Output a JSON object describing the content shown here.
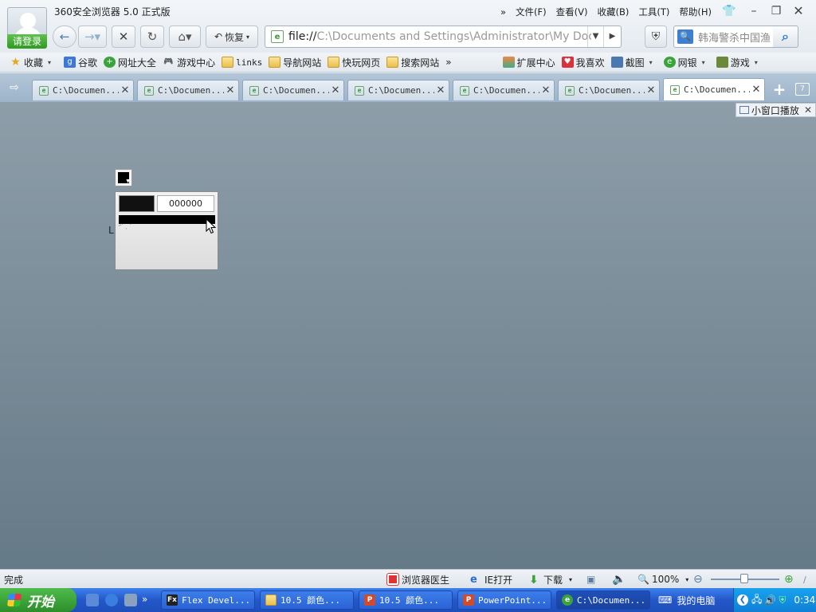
{
  "window": {
    "title": "360安全浏览器 5.0 正式版",
    "login_label": "请登录",
    "menu": [
      "»",
      "文件(F)",
      "查看(V)",
      "收藏(B)",
      "工具(T)",
      "帮助(H)"
    ],
    "restore_label": "恢复"
  },
  "address": {
    "scheme": "file://",
    "path": "C:\\Documents and Settings\\Administrator\\My Documen"
  },
  "search": {
    "placeholder": "韩海警杀中国渔"
  },
  "bookmarks": {
    "left": [
      {
        "label": "收藏",
        "icon": "star-icon"
      },
      {
        "label": "谷歌",
        "icon": "google-icon"
      },
      {
        "label": "网址大全",
        "icon": "url-guide-icon"
      },
      {
        "label": "游戏中心",
        "icon": "gamepad-icon"
      },
      {
        "label": "links",
        "icon": "folder-icon"
      },
      {
        "label": "导航网站",
        "icon": "folder-icon"
      },
      {
        "label": "快玩网页",
        "icon": "folder-icon"
      },
      {
        "label": "搜索网站",
        "icon": "folder-icon"
      }
    ],
    "more": "»",
    "right": [
      {
        "label": "扩展中心",
        "icon": "extension-icon"
      },
      {
        "label": "我喜欢",
        "icon": "heart-icon"
      },
      {
        "label": "截图",
        "icon": "screenshot-icon"
      },
      {
        "label": "网银",
        "icon": "bank-icon"
      },
      {
        "label": "游戏",
        "icon": "game-icon"
      }
    ]
  },
  "tabs": [
    {
      "label": "C:\\Documen..."
    },
    {
      "label": "C:\\Documen..."
    },
    {
      "label": "C:\\Documen..."
    },
    {
      "label": "C:\\Documen..."
    },
    {
      "label": "C:\\Documen..."
    },
    {
      "label": "C:\\Documen..."
    },
    {
      "label": "C:\\Documen...",
      "active": true
    }
  ],
  "tab_count": "7",
  "content": {
    "mini_window_label": "小窗口播放",
    "picker_hex": "000000",
    "stray_label": "L",
    "picker_dots": "ᶦ'ˋ ˎ               ˋ"
  },
  "statusbar": {
    "status": "完成",
    "doctor": "浏览器医生",
    "ie_open": "IE打开",
    "download": "下载",
    "zoom": "100%",
    "zoom_level": 0.5
  },
  "taskbar": {
    "start": "开始",
    "tasks": [
      {
        "label": "Flex Devel...",
        "icon": "flex-icon"
      },
      {
        "label": "10.5 颜色...",
        "icon": "folder-icon"
      },
      {
        "label": "10.5 颜色...",
        "icon": "powerpoint-icon"
      },
      {
        "label": "PowerPoint...",
        "icon": "powerpoint-icon"
      },
      {
        "label": "C:\\Documen...",
        "icon": "browser-icon",
        "active": true
      }
    ],
    "my_computer": "我的电脑",
    "clock": "0:34"
  },
  "colors": {
    "content_top": "#8e9ea9",
    "content_bottom": "#657a87",
    "taskbar": "#2457c8",
    "start_green": "#2d8e2a"
  }
}
